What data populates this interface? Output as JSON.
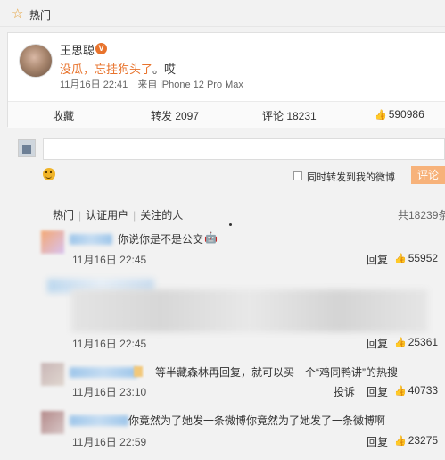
{
  "header": {
    "title": "热门",
    "icon": "star-icon"
  },
  "post": {
    "author": "王思聪",
    "verified_badge": "V",
    "text_prefix": "没瓜，",
    "text_highlight": "忘挂狗头了",
    "text_suffix": "。哎",
    "time": "11月16日 22:41",
    "source": "来自 iPhone 12 Pro Max",
    "actions": {
      "collect": "收藏",
      "repost": "转发 2097",
      "comment": "评论 18231",
      "like": "590986"
    }
  },
  "composer": {
    "also_repost_label": "同时转发到我的微博",
    "submit_label": "评论"
  },
  "filters": {
    "items": [
      "热门",
      "认证用户",
      "关注的人"
    ],
    "total": "共18239条"
  },
  "comments": [
    {
      "text": "你说你是不是公交",
      "time": "11月16日 22:45",
      "reply": "回复",
      "likes": "55952"
    },
    {
      "text": "",
      "time": "11月16日 22:45",
      "reply": "回复",
      "likes": "25361"
    },
    {
      "text": "等半藏森林再回复，就可以买一个“鸡同鸭讲”的热搜",
      "time": "11月16日 23:10",
      "report": "投诉",
      "reply": "回复",
      "likes": "40733"
    },
    {
      "text": "你竟然为了她发一条微博你竟然为了她发了一条微博啊",
      "time": "11月16日 22:59",
      "reply": "回复",
      "likes": "23275"
    }
  ],
  "colors": {
    "accent_orange": "#e8732c",
    "submit_bg": "#f7b27a",
    "link_blue": "#9ec6ea"
  }
}
